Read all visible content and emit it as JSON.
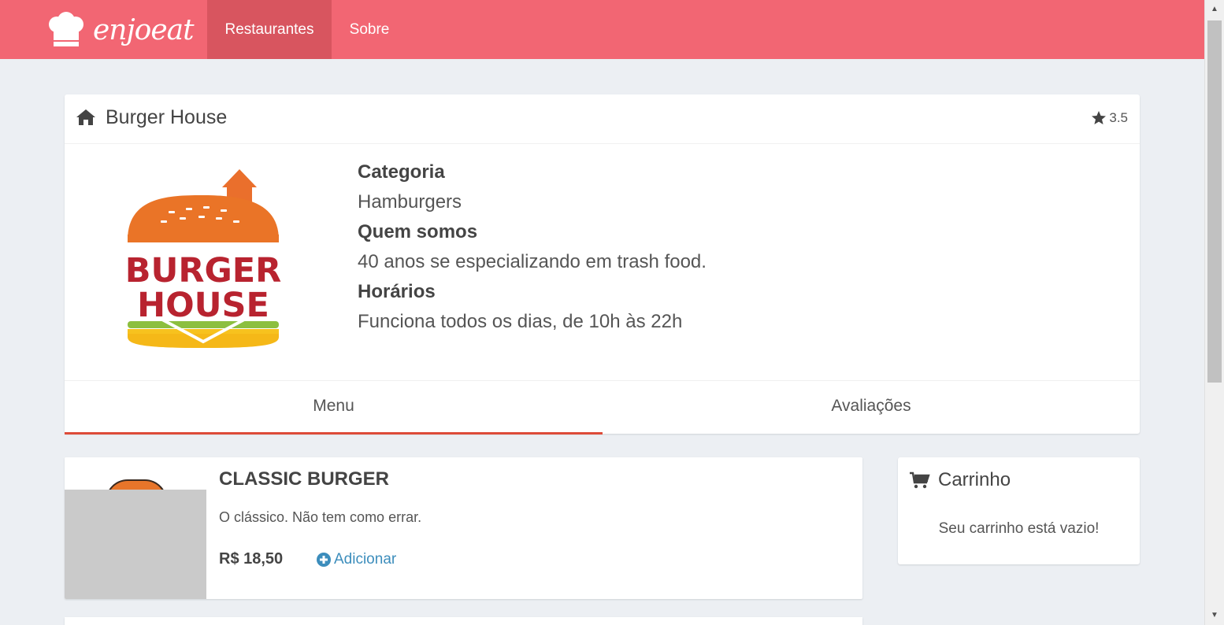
{
  "nav": {
    "brand": "enjoeat",
    "items": [
      {
        "label": "Restaurantes",
        "active": true
      },
      {
        "label": "Sobre",
        "active": false
      }
    ],
    "color": "#f26673"
  },
  "restaurant": {
    "name": "Burger House",
    "rating": "3.5",
    "logo_text_line1": "BURGER",
    "logo_text_line2": "HOUSE",
    "category_label": "Categoria",
    "category": "Hamburgers",
    "about_label": "Quem somos",
    "about": "40 anos se especializando em trash food.",
    "hours_label": "Horários",
    "hours": "Funciona todos os dias, de 10h às 22h"
  },
  "tabs": [
    {
      "label": "Menu",
      "active": true
    },
    {
      "label": "Avaliações",
      "active": false
    }
  ],
  "menu_items": [
    {
      "name": "CLASSIC BURGER",
      "description": "O clássico. Não tem como errar.",
      "price": "R$ 18,50",
      "add_label": "Adicionar"
    }
  ],
  "cart": {
    "title": "Carrinho",
    "empty_message": "Seu carrinho está vazio!"
  },
  "icons": {
    "home": "home-icon",
    "star": "star-icon",
    "cart": "shopping-cart-icon",
    "add": "plus-circle-icon"
  },
  "colors": {
    "accent_tab": "#dd4b39",
    "link": "#3c8dbc"
  }
}
